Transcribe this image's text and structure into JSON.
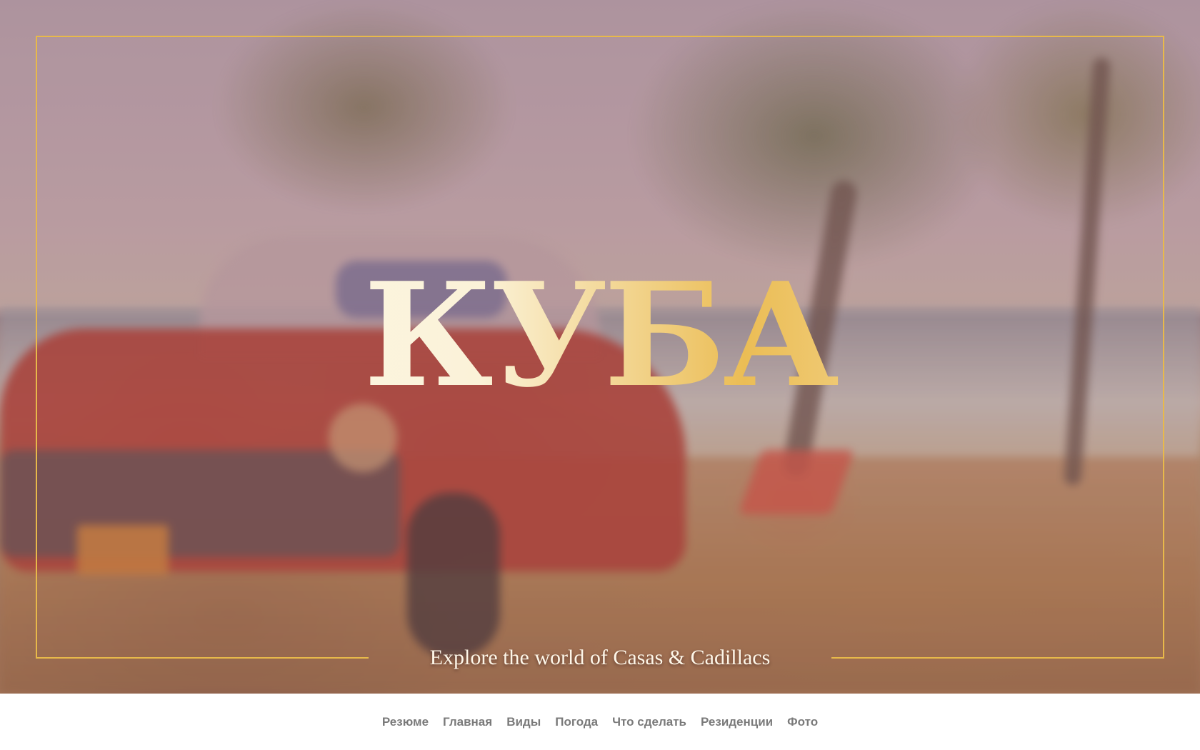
{
  "hero": {
    "title": "КУБА",
    "subtitle": "Explore the world of Casas & Cadillacs",
    "frame_color": "#e8b94a",
    "photo_description_icon": "beach-car-photo"
  },
  "nav": {
    "items": [
      {
        "label": "Резюме"
      },
      {
        "label": "Главная"
      },
      {
        "label": "Виды"
      },
      {
        "label": "Погода"
      },
      {
        "label": "Что сделать"
      },
      {
        "label": "Резиденции"
      },
      {
        "label": "Фото"
      }
    ],
    "text_color": "#7a7a7a"
  }
}
